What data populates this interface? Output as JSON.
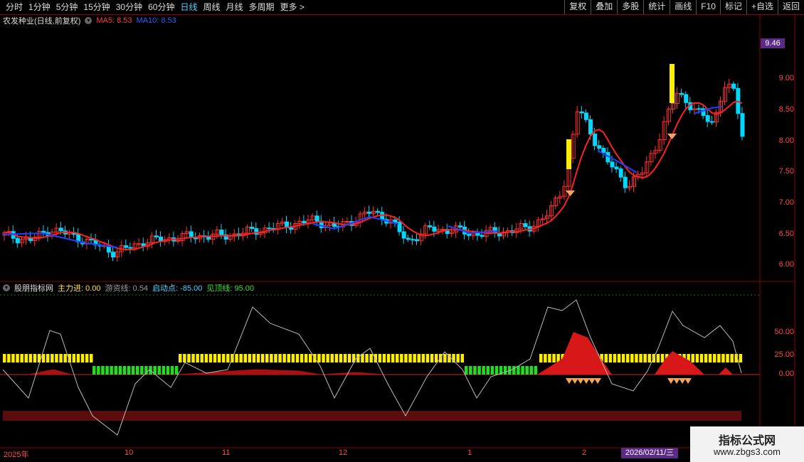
{
  "toolbar": {
    "periods": [
      "分时",
      "1分钟",
      "5分钟",
      "15分钟",
      "30分钟",
      "60分钟",
      "日线",
      "周线",
      "月线",
      "多周期",
      "更多 >"
    ],
    "active_period": "日线",
    "actions": [
      "复权",
      "叠加",
      "多股",
      "统计",
      "画线",
      "F10",
      "标记",
      "+自选",
      "返回"
    ]
  },
  "main_chart": {
    "title": "农发种业(日线,前复权)",
    "ma5_label": "MA5: 8.53",
    "ma10_label": "MA10: 8.53",
    "price_tag": "9.46",
    "y_ticks": [
      "9.00",
      "8.50",
      "8.00",
      "7.50",
      "7.00",
      "6.50",
      "6.00"
    ]
  },
  "sub_chart": {
    "title": "股朋指标网",
    "zlj": "主力进: 0.00",
    "yzx": "游资线: 0.54",
    "qdd": "启动点: -85.00",
    "jdx": "见顶线: 95.00",
    "y_ticks": [
      "50.00",
      "25.00",
      "0.00"
    ]
  },
  "x_axis": {
    "labels": [
      "2025年",
      "10",
      "11",
      "12",
      "1",
      "2"
    ],
    "cursor_date": "2026/02/11/三"
  },
  "watermark": {
    "title": "指标公式网",
    "url": "www.zbgs3.com"
  },
  "colors": {
    "up": "#ff3030",
    "down": "#00d8ff",
    "ma5": "#ff2020",
    "ma10": "#2040ff",
    "yellow_bar": "#ffee00",
    "green_bar": "#22dd22"
  }
}
